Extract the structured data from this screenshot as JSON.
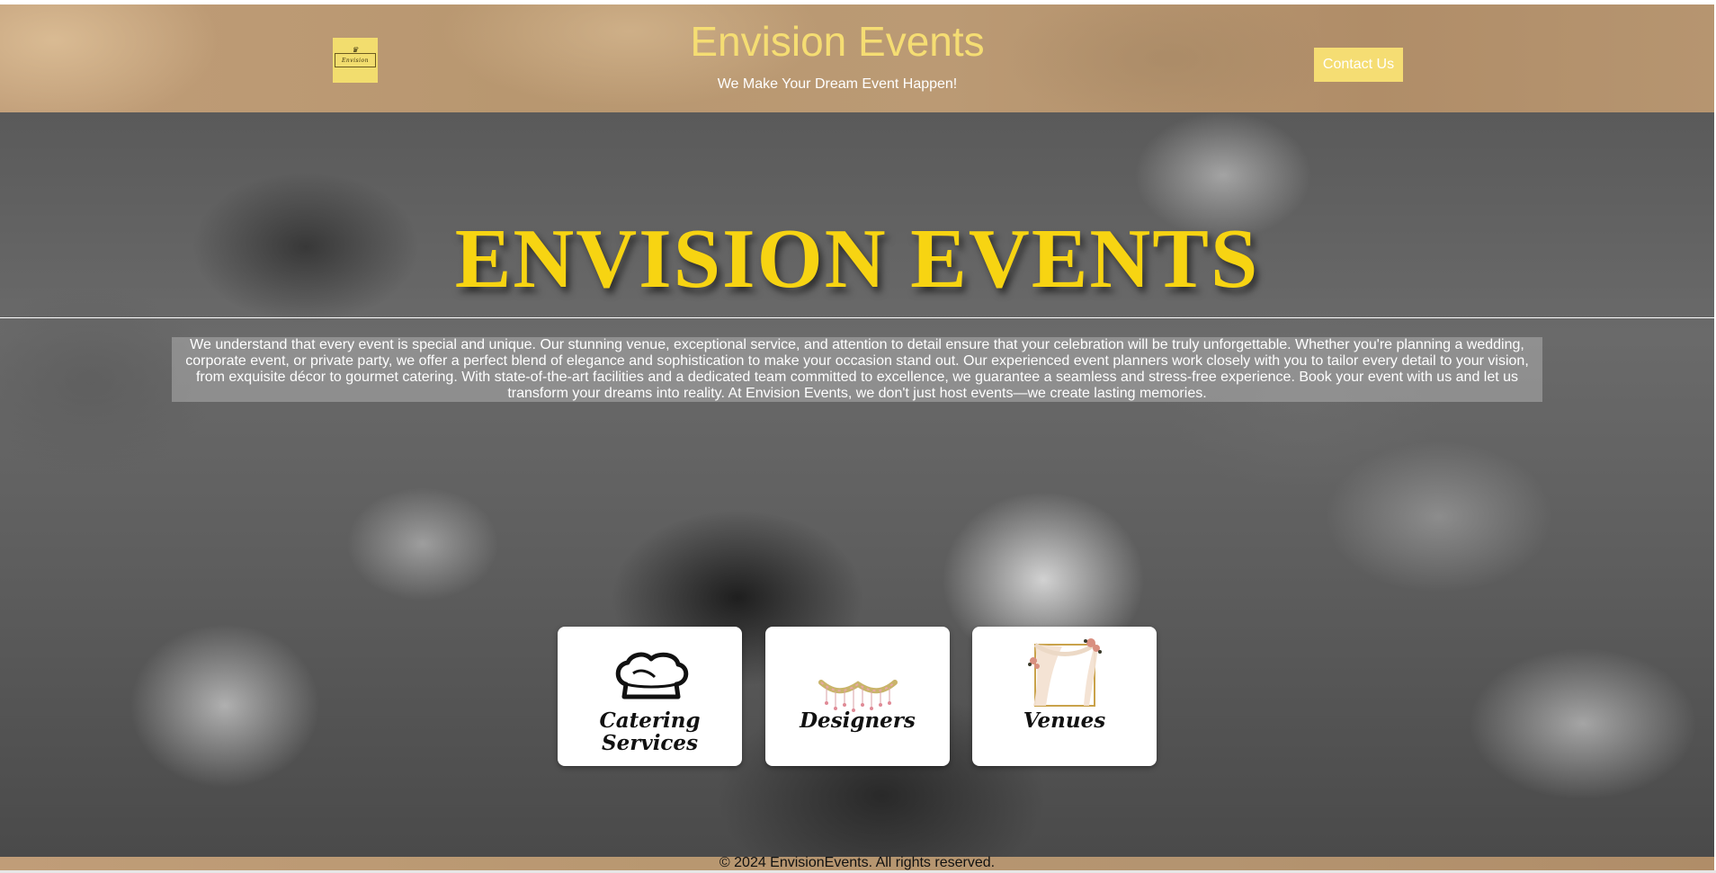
{
  "header": {
    "logo_text": "Envision",
    "site_title": "Envision Events",
    "tagline": "We Make Your Dream Event Happen!",
    "contact_button": "Contact Us"
  },
  "hero": {
    "title": "ENVISION EVENTS",
    "description": "We understand that every event is special and unique. Our stunning venue, exceptional service, and attention to detail ensure that your celebration will be truly unforgettable. Whether you're planning a wedding, corporate event, or private party, we offer a perfect blend of elegance and sophistication to make your occasion stand out. Our experienced event planners work closely with you to tailor every detail to your vision, from exquisite décor to gourmet catering. With state-of-the-art facilities and a dedicated team committed to excellence, we guarantee a seamless and stress-free experience. Book your event with us and let us transform your dreams into reality. At Envision Events, we don't just host events—we create lasting memories."
  },
  "cards": [
    {
      "label": "Catering Services",
      "icon": "chef-hat-icon"
    },
    {
      "label": "Designers",
      "icon": "garland-icon"
    },
    {
      "label": "Venues",
      "icon": "floral-arch-icon"
    }
  ],
  "footer": {
    "copyright": "© 2024 EnvisionEvents. All rights reserved."
  },
  "colors": {
    "accent_yellow": "#f5dd73",
    "hero_title": "#f7d412",
    "header_tan": "#b89770"
  }
}
